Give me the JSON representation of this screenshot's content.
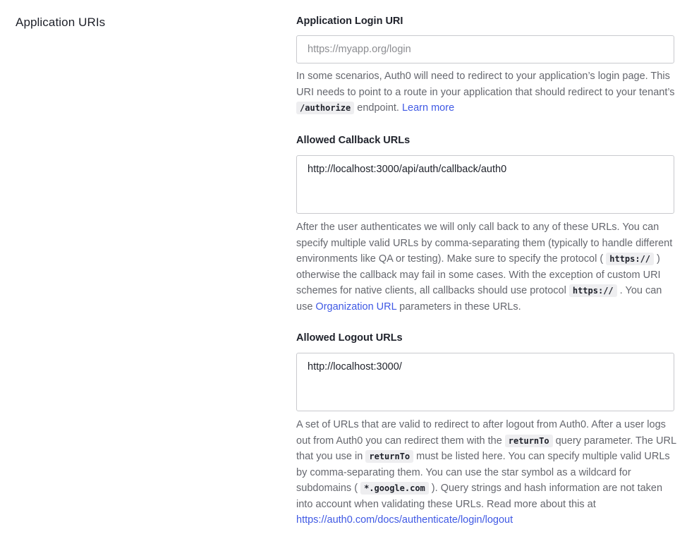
{
  "section": {
    "title": "Application URIs"
  },
  "login_uri": {
    "label": "Application Login URI",
    "placeholder": "https://myapp.org/login",
    "value": "",
    "help": {
      "t1": "In some scenarios, Auth0 will need to redirect to your application’s login page. This URI needs to point to a route in your application that should redirect to your tenant’s ",
      "code1": "/authorize",
      "t2": " endpoint. ",
      "link": "Learn more"
    }
  },
  "callback_urls": {
    "label": "Allowed Callback URLs",
    "value": "http://localhost:3000/api/auth/callback/auth0",
    "help": {
      "t1": "After the user authenticates we will only call back to any of these URLs. You can specify multiple valid URLs by comma-separating them (typically to handle different environments like QA or testing). Make sure to specify the protocol ( ",
      "code1": "https://",
      "t2": " ) otherwise the callback may fail in some cases. With the exception of custom URI schemes for native clients, all callbacks should use protocol ",
      "code2": "https://",
      "t3": " . You can use ",
      "link": "Organization URL",
      "t4": " parameters in these URLs."
    }
  },
  "logout_urls": {
    "label": "Allowed Logout URLs",
    "value": "http://localhost:3000/",
    "help": {
      "t1": "A set of URLs that are valid to redirect to after logout from Auth0. After a user logs out from Auth0 you can redirect them with the ",
      "code1": "returnTo",
      "t2": " query parameter. The URL that you use in ",
      "code2": "returnTo",
      "t3": " must be listed here. You can specify multiple valid URLs by comma-separating them. You can use the star symbol as a wildcard for subdomains ( ",
      "code3": "*.google.com",
      "t4": " ). Query strings and hash information are not taken into account when validating these URLs. Read more about this at ",
      "link": "https://auth0.com/docs/authenticate/login/logout"
    }
  },
  "colors": {
    "link": "#3f59e4",
    "border": "#c9cace",
    "help_text": "#65676e"
  }
}
